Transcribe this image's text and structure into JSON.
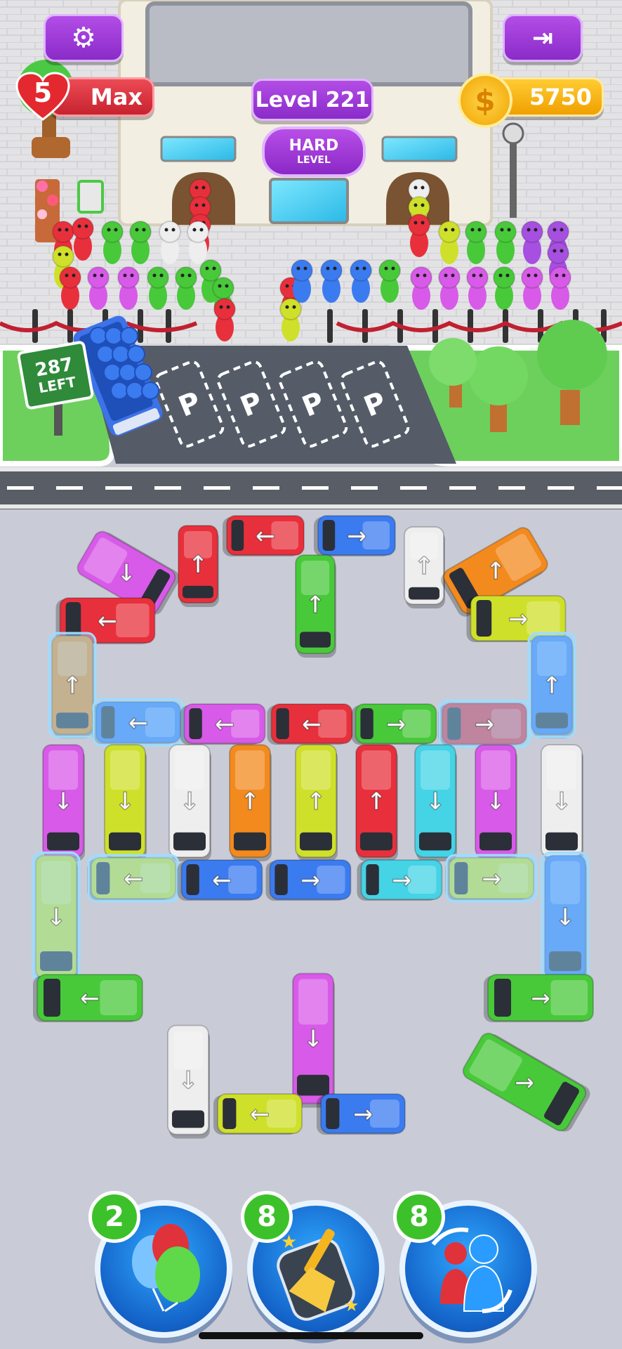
{
  "hud": {
    "lives_count": "5",
    "lives_label": "Max",
    "level_label": "Level 221",
    "coins": "5750",
    "difficulty_main": "HARD",
    "difficulty_sub": "LEVEL",
    "settings_icon": "gear-icon",
    "exit_icon": "exit-door-icon",
    "heart_icon": "heart-icon",
    "coin_icon": "dollar-coin-icon"
  },
  "sign": {
    "count": "287",
    "label": "LEFT"
  },
  "boosters": [
    {
      "name": "balloons",
      "count": "2",
      "icon": "balloons-icon"
    },
    {
      "name": "sweep",
      "count": "8",
      "icon": "broom-icon"
    },
    {
      "name": "swap",
      "count": "8",
      "icon": "swap-people-icon"
    }
  ],
  "parking_label": "P",
  "colors": {
    "red": "#e8303c",
    "blue": "#3b7bf0",
    "green": "#48c93a",
    "yellow": "#cfe02a",
    "magenta": "#d85ae8",
    "orange": "#f28a1e",
    "white": "#eeeeee",
    "cyan": "#45d3e6",
    "pink": "#e454d8",
    "purple": "#a64fe0",
    "lime": "#b8d92e"
  }
}
